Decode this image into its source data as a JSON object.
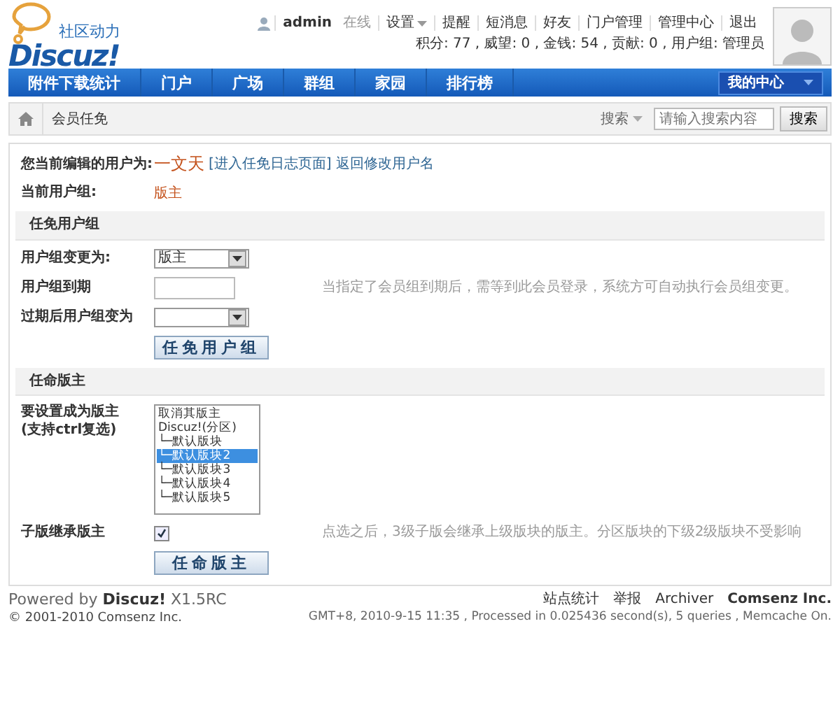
{
  "header": {
    "tagline": "社区动力",
    "logo": "Discuz!",
    "user": "admin",
    "status": "在线",
    "menu": [
      {
        "label": "设置",
        "dropdown": true
      },
      {
        "label": "提醒",
        "dropdown": false
      },
      {
        "label": "短消息",
        "dropdown": false
      },
      {
        "label": "好友",
        "dropdown": false
      },
      {
        "label": "门户管理",
        "dropdown": false
      },
      {
        "label": "管理中心",
        "dropdown": false
      },
      {
        "label": "退出",
        "dropdown": false
      }
    ],
    "stats": "积分: 77 , 威望: 0 , 金钱: 54 , 贡献: 0 , 用户组: 管理员"
  },
  "nav": {
    "items": [
      {
        "label": "附件下载统计",
        "selected": false
      },
      {
        "label": "门户",
        "selected": false
      },
      {
        "label": "广场",
        "selected": false
      },
      {
        "label": "群组",
        "selected": false
      },
      {
        "label": "家园",
        "selected": false
      },
      {
        "label": "排行榜",
        "selected": false
      }
    ],
    "my_center": "我的中心"
  },
  "breadcrumb": {
    "current": "会员任免"
  },
  "search": {
    "scope": "搜索",
    "placeholder": "请输入搜索内容",
    "button": "搜索"
  },
  "form": {
    "rows": [
      {
        "kind": "user",
        "label": "您当前编辑的用户为:",
        "value": "一文天",
        "links": [
          "[进入任免日志页面]",
          "返回修改用户名"
        ]
      },
      {
        "kind": "text",
        "label": "当前用户组:",
        "value": "版主"
      },
      {
        "kind": "section",
        "label": "任免用户组"
      },
      {
        "kind": "select",
        "label": "用户组变更为:",
        "value": "版主"
      },
      {
        "kind": "input",
        "label": "用户组到期",
        "hint": "当指定了会员组到期后，需等到此会员登录，系统方可自动执行会员组变更。"
      },
      {
        "kind": "select",
        "label": "过期后用户组变为"
      },
      {
        "kind": "button",
        "label": "任免用户组"
      },
      {
        "kind": "section",
        "label": "任命版主"
      },
      {
        "kind": "listbox",
        "label": "要设置成为版主",
        "sublabel": "(支持ctrl复选)",
        "options": [
          {
            "label": "取消其版主",
            "selected": false
          },
          {
            "label": "Discuz!(分区)",
            "selected": false
          },
          {
            "label": "└─默认版块",
            "selected": false
          },
          {
            "label": "└─默认版块2",
            "selected": true
          },
          {
            "label": "└─默认版块3",
            "selected": false
          },
          {
            "label": "└─默认版块4",
            "selected": false
          },
          {
            "label": "└─默认版块5",
            "selected": false
          }
        ]
      },
      {
        "kind": "checkbox",
        "label": "子版继承版主",
        "checked": true,
        "hint": "点选之后，3级子版会继承上级版块的版主。分区版块的下级2级版块不受影响"
      },
      {
        "kind": "button",
        "label": "任命版主"
      }
    ]
  },
  "footer": {
    "powered": "Powered by **Discuz!** X1.5RC",
    "copyright": "© 2001-2010 Comsenz Inc.",
    "links": [
      "站点统计",
      "举报",
      "Archiver",
      "Comsenz Inc."
    ],
    "info": "GMT+8, 2010-9-15 11:35 , Processed in 0.025436 second(s), 5 queries , Memcache On."
  }
}
